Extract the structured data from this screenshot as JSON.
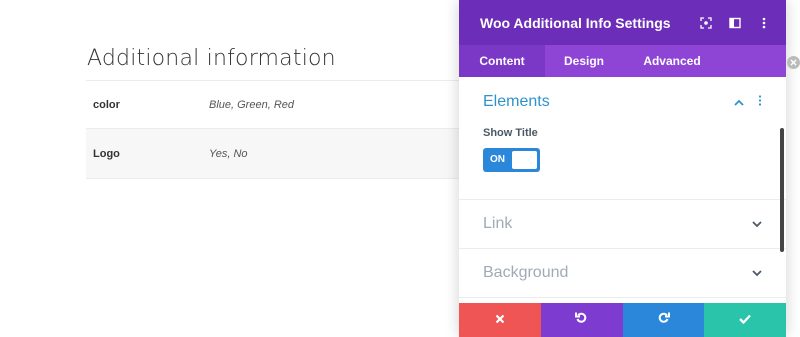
{
  "page": {
    "heading": "Additional information",
    "attributes": [
      {
        "name": "color",
        "value": "Blue, Green, Red"
      },
      {
        "name": "Logo",
        "value": "Yes, No"
      }
    ]
  },
  "modal": {
    "title": "Woo Additional Info Settings",
    "header_icons": [
      "focus-icon",
      "sidebar-layout-icon",
      "more-vertical-icon"
    ],
    "tabs": [
      {
        "label": "Content",
        "active": true
      },
      {
        "label": "Design",
        "active": false
      },
      {
        "label": "Advanced",
        "active": false
      }
    ],
    "sections": {
      "elements": {
        "title": "Elements",
        "show_title_label": "Show Title",
        "toggle_text": "ON"
      },
      "link": {
        "title": "Link"
      },
      "background": {
        "title": "Background"
      }
    },
    "footer_buttons": [
      "close-icon",
      "undo-icon",
      "redo-icon",
      "check-icon"
    ]
  },
  "colors": {
    "header_purple": "#6c2eb9",
    "tabs_purple": "#8e44d4",
    "active_tab": "#7b37c6",
    "accent_blue": "#2b87da",
    "section_open_blue": "#2e93cc",
    "close_red": "#ef5555",
    "undo_purple": "#7e3bd0",
    "save_teal": "#29c4a9"
  }
}
